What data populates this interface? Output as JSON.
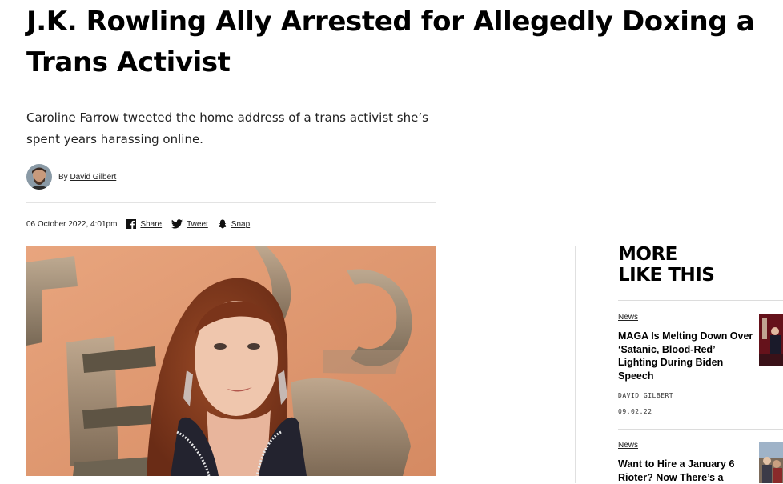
{
  "article": {
    "headline": "J.K. Rowling Ally Arrested for Allegedly Doxing a Trans Activist",
    "dek": "Caroline Farrow tweeted the home address of a trans activist she’s spent years harassing online.",
    "by_prefix": "By",
    "author": "David Gilbert",
    "date": "06 October 2022, 4:01pm",
    "share": [
      {
        "label": "Share",
        "icon": "facebook-icon"
      },
      {
        "label": "Tweet",
        "icon": "twitter-icon"
      },
      {
        "label": "Snap",
        "icon": "snapchat-icon"
      }
    ]
  },
  "sidebar": {
    "title_line1": "MORE",
    "title_line2": "LIKE THIS",
    "cards": [
      {
        "category": "News",
        "title": "MAGA Is Melting Down Over ‘Satanic, Blood-Red’ Lighting During Biden Speech",
        "author": "DAVID GILBERT",
        "date": "09.02.22"
      },
      {
        "category": "News",
        "title": "Want to Hire a January 6 Rioter? Now There’s a"
      }
    ]
  }
}
